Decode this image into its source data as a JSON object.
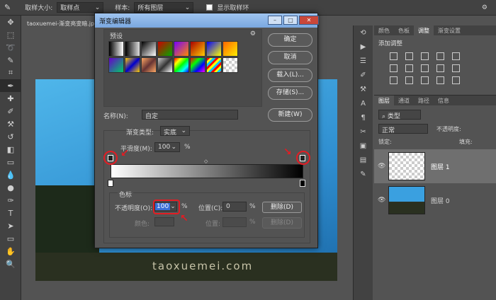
{
  "optbar": {
    "sample_size_label": "取样大小:",
    "sample_size_value": "取样点",
    "sample_label": "样本:",
    "sample_value": "所有图层",
    "show_ring_label": "显示取样环"
  },
  "document": {
    "tab": "taoxuemei-渐变亮变暗.jpg",
    "watermark": "taoxuemei.com"
  },
  "adjust_panel": {
    "tabs": [
      "颜色",
      "色板",
      "调整",
      "渐变设置"
    ],
    "active_tab": "调整",
    "title": "添加调整"
  },
  "layers_panel": {
    "tabs": [
      "图层",
      "通道",
      "路径",
      "信息"
    ],
    "kind_label": "类型",
    "blend_mode": "正常",
    "opacity_label": "不透明度:",
    "lock_label": "锁定:",
    "fill_label": "填充:",
    "layers": [
      {
        "name": "图层 1"
      },
      {
        "name": "图层 0"
      }
    ]
  },
  "dialog": {
    "title": "渐变编辑器",
    "preset_label": "预设",
    "buttons": {
      "ok": "确定",
      "cancel": "取消",
      "load": "载入(L)...",
      "save": "存储(S)...",
      "new": "新建(W)",
      "delete1": "删除(D)",
      "delete2": "删除(D)"
    },
    "name_label": "名称(N):",
    "name_value": "自定",
    "gradient_type_label": "渐变类型:",
    "gradient_type_value": "实底",
    "smoothness_label": "平滑度(M):",
    "smoothness_value": "100",
    "percent": "%",
    "stops_group_label": "色标",
    "opacity_label": "不透明度(O):",
    "opacity_value": "100",
    "position_label": "位置(C):",
    "position_value": "0",
    "color_label": "颜色:",
    "position2_label": "位置:"
  }
}
